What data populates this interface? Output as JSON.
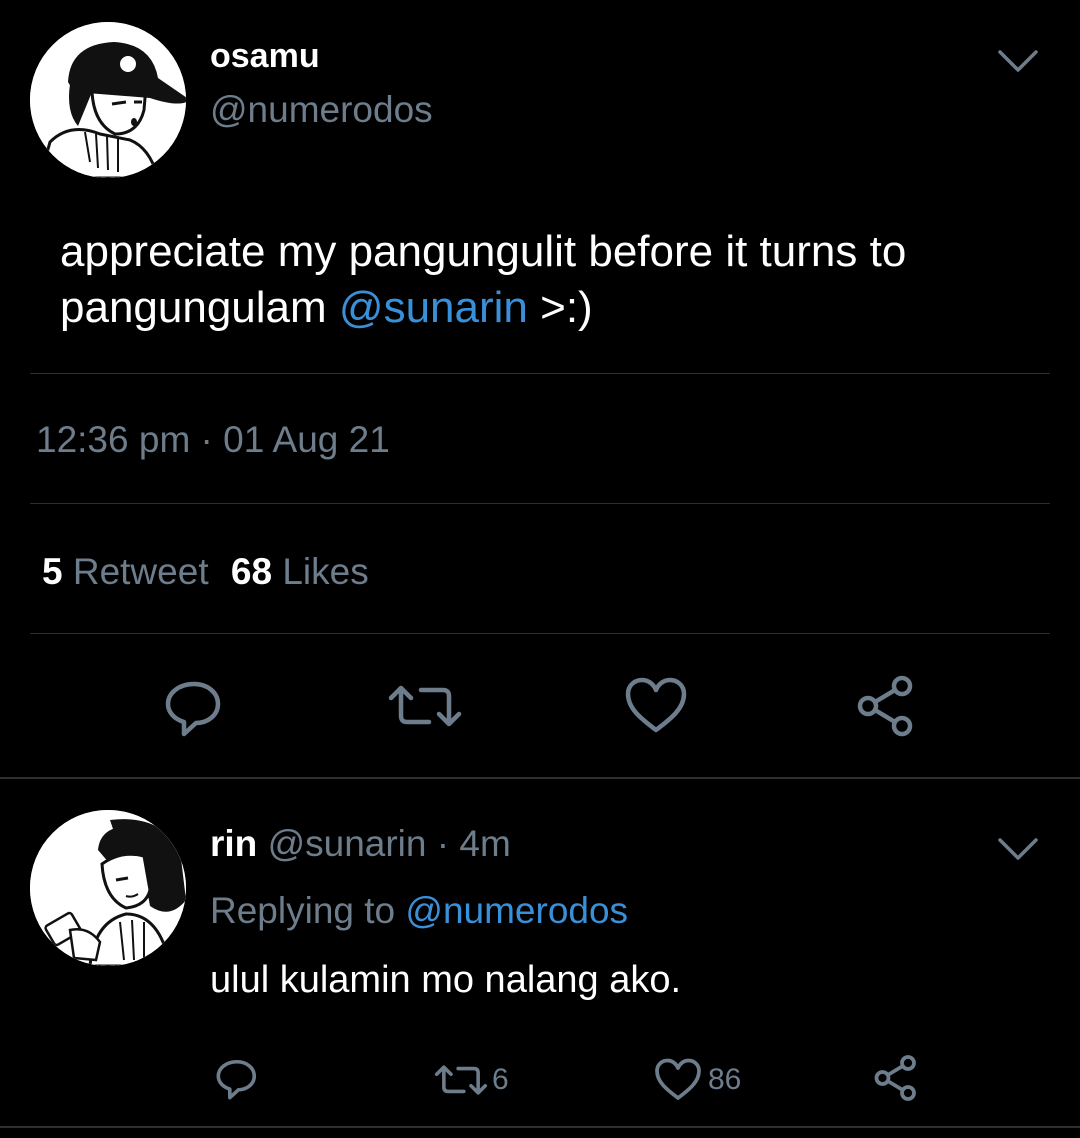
{
  "main_tweet": {
    "display_name": "osamu",
    "handle": "@numerodos",
    "text_part1": "appreciate my pangungulit before it turns to",
    "text_part2": "pangungulam",
    "mention": "@sunarin",
    "text_part3": ">:)",
    "timestamp": "12:36 pm · 01 Aug 21",
    "retweet_count": "5",
    "retweet_label": "Retweet",
    "like_count": "68",
    "like_label": "Likes"
  },
  "reply": {
    "display_name": "rin",
    "handle": "@sunarin",
    "age": "· 4m",
    "replying_to_label": "Replying to",
    "replying_to_handle": "@numerodos",
    "text": "ulul kulamin mo nalang ako.",
    "retweet_count": "6",
    "like_count": "86"
  },
  "icons": {
    "reply": "reply-icon",
    "retweet": "retweet-icon",
    "like": "heart-icon",
    "share": "share-icon",
    "menu": "chevron-down-icon"
  },
  "colors": {
    "background": "#000000",
    "text": "#ffffff",
    "muted": "#6e7d8c",
    "link": "#3a8fd9",
    "divider": "#2b2e33"
  }
}
